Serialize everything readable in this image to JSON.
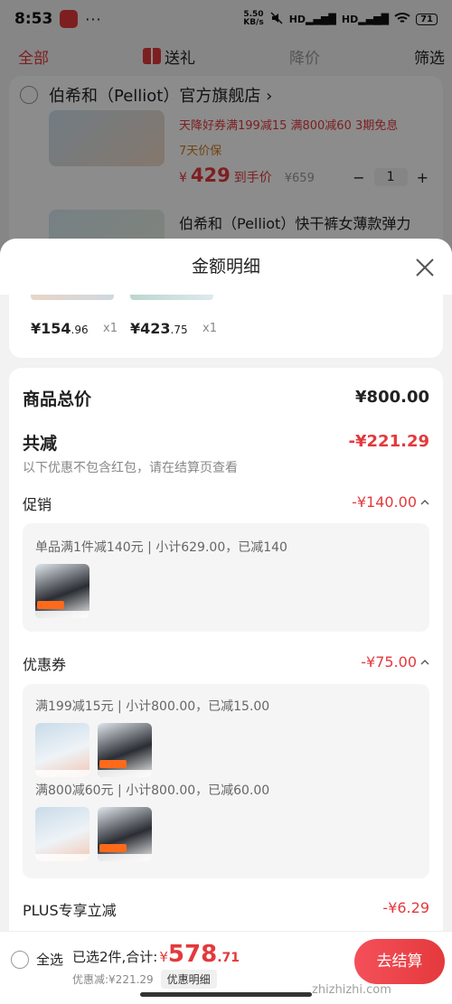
{
  "status_bar": {
    "time": "8:53",
    "dots": "···",
    "speed_top": "5.50",
    "speed_bottom": "KB/s",
    "signal_1": "HD",
    "signal_2": "HD",
    "battery": "71"
  },
  "filter_bar": {
    "all": "全部",
    "gift": "送礼",
    "price_down": "降价",
    "filter": "筛选"
  },
  "background_cart": {
    "shop_name": "伯希和（Pelliot）官方旗舰店",
    "shop_chevron": "›",
    "product1_promo": "天降好券满199减15  满800减60  3期免息",
    "product1_service": "7天价保",
    "product1_price_symbol": "¥",
    "product1_price": "429",
    "product1_price_suffix": "到手价",
    "product1_orig": "¥659",
    "minus": "−",
    "qty": "1",
    "plus": "+",
    "product2_title": "伯希和（Pelliot）快干裤女薄款弹力"
  },
  "sheet": {
    "title": "金额明细",
    "items": [
      {
        "price_main": "¥154",
        "price_dec": ".96",
        "qty": "x1"
      },
      {
        "price_main": "¥423",
        "price_dec": ".75",
        "qty": "x1"
      }
    ],
    "total_label": "商品总价",
    "total_value": "¥800.00",
    "reduce_label": "共减",
    "reduce_value": "-¥221.29",
    "reduce_note": "以下优惠不包含红包，请在结算页查看",
    "promo": {
      "label": "促销",
      "value": "-¥140.00",
      "line": "单品满1件减140元 | 小计629.00，已减140"
    },
    "coupon": {
      "label": "优惠券",
      "value": "-¥75.00",
      "line1": "满199减15元 | 小计800.00，已减15.00",
      "line2": "满800减60元 | 小计800.00，已减60.00"
    },
    "plus": {
      "label": "PLUS专享立减",
      "value": "-¥6.29"
    }
  },
  "bottom_bar": {
    "select_all": "全选",
    "selected_prefix": "已选2件,合计:",
    "currency": "¥",
    "total_int": "578",
    "total_dec": ".71",
    "discount": "优惠减:¥221.29",
    "detail_chip": "优惠明细",
    "checkout": "去结算"
  },
  "watermark": "zhizhizhi.com",
  "colors": {
    "accent": "#e4393c",
    "muted": "#888888"
  }
}
